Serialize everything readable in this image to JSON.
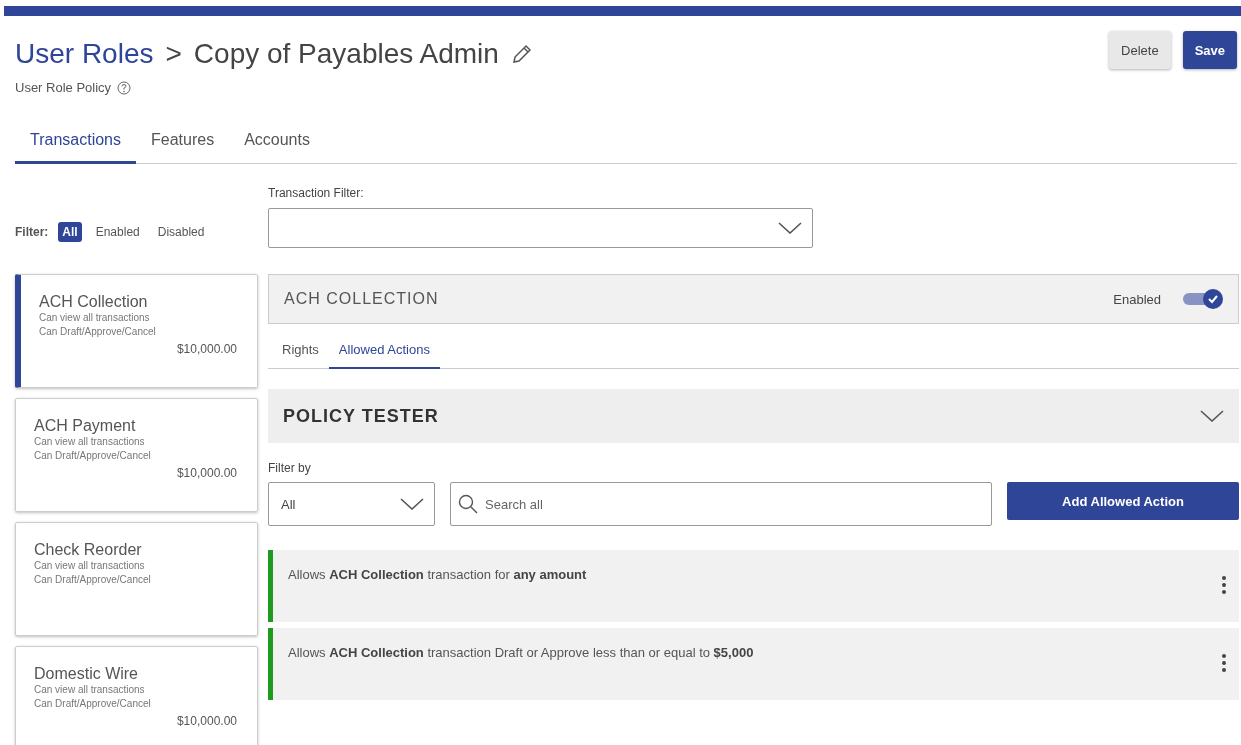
{
  "breadcrumb": {
    "parent": "User Roles",
    "separator": ">",
    "current": "Copy of Payables Admin"
  },
  "subtitle": "User Role Policy",
  "buttons": [
    {
      "label": "Delete",
      "kind": "secondary"
    },
    {
      "label": "Save",
      "kind": "primary"
    }
  ],
  "tabs": [
    {
      "label": "Transactions",
      "selected": true
    },
    {
      "label": "Features",
      "selected": false
    },
    {
      "label": "Accounts",
      "selected": false
    }
  ],
  "filter": {
    "label": "Filter:",
    "options": [
      {
        "label": "All",
        "selected": true
      },
      {
        "label": "Enabled",
        "selected": false
      },
      {
        "label": "Disabled",
        "selected": false
      }
    ]
  },
  "transaction_filter": {
    "label": "Transaction Filter:"
  },
  "transactions": [
    {
      "name": "ACH Collection",
      "lines": [
        "Can view all transactions",
        "Can Draft/Approve/Cancel"
      ],
      "amount": "$10,000.00",
      "selected": true
    },
    {
      "name": "ACH Payment",
      "lines": [
        "Can view all transactions",
        "Can Draft/Approve/Cancel"
      ],
      "amount": "$10,000.00",
      "selected": false
    },
    {
      "name": "Check Reorder",
      "lines": [
        "Can view all transactions",
        "Can Draft/Approve/Cancel"
      ],
      "selected": false
    },
    {
      "name": "Domestic Wire",
      "lines": [
        "Can view all transactions",
        "Can Draft/Approve/Cancel"
      ],
      "amount": "$10,000.00",
      "selected": false
    }
  ],
  "detail": {
    "title": "ACH COLLECTION",
    "status_label": "Enabled",
    "enabled": true,
    "subtabs": [
      {
        "label": "Rights",
        "selected": false
      },
      {
        "label": "Allowed Actions",
        "selected": true
      }
    ],
    "policy_tester": {
      "title": "POLICY TESTER",
      "expanded": false
    },
    "filter_by": {
      "label": "Filter by",
      "value": "All"
    },
    "search": {
      "placeholder": "Search all"
    },
    "add_button": "Add Allowed Action",
    "actions": [
      {
        "text": "Allows **ACH Collection** transaction for **any amount**",
        "color": "#1e9a1e"
      },
      {
        "text": "Allows **ACH Collection** transaction Draft or Approve less than or equal to **$5,000**",
        "color": "#1e9a1e"
      }
    ]
  }
}
